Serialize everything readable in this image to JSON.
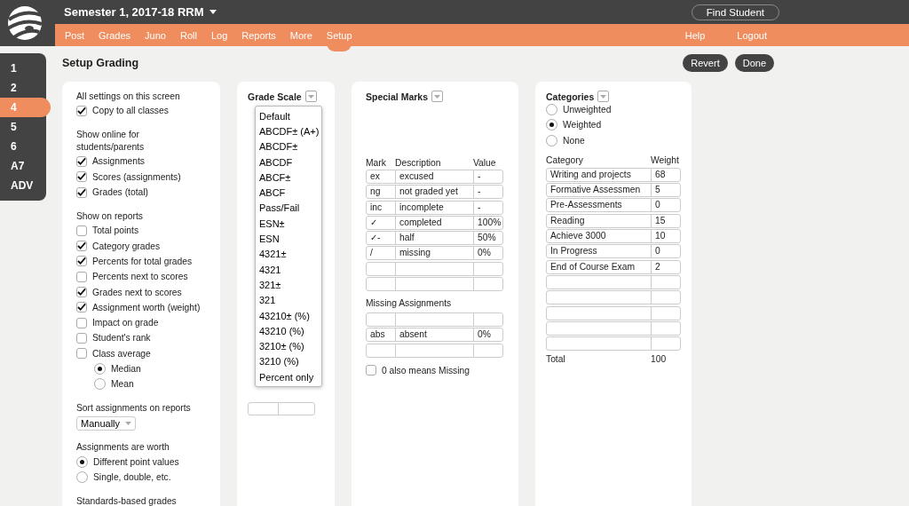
{
  "app": {
    "title": "Semester 1, 2017-18 RRM",
    "find_button": "Find Student"
  },
  "nav": {
    "items": [
      {
        "label": "Post",
        "selected": false
      },
      {
        "label": "Grades",
        "selected": false
      },
      {
        "label": "Juno",
        "selected": false
      },
      {
        "label": "Roll",
        "selected": false
      },
      {
        "label": "Log",
        "selected": false
      },
      {
        "label": "Reports",
        "selected": false
      },
      {
        "label": "More",
        "selected": false
      },
      {
        "label": "Setup",
        "selected": true
      }
    ],
    "right": [
      "Help",
      "Logout"
    ]
  },
  "class_tabs": [
    {
      "label": "1",
      "selected": false
    },
    {
      "label": "2",
      "selected": false
    },
    {
      "label": "4",
      "selected": true
    },
    {
      "label": "5",
      "selected": false
    },
    {
      "label": "6",
      "selected": false
    },
    {
      "label": "A7",
      "selected": false
    },
    {
      "label": "ADV",
      "selected": false
    }
  ],
  "page_title": "Setup Grading",
  "actions": [
    "Revert",
    "Done"
  ],
  "settings": {
    "sections": [
      {
        "heading": "All settings on this screen",
        "items": [
          {
            "kind": "checkbox",
            "label": "Copy to all classes",
            "checked": true
          }
        ]
      },
      {
        "heading": "Show online for students/parents",
        "items": [
          {
            "kind": "checkbox",
            "label": "Assignments",
            "checked": true
          },
          {
            "kind": "checkbox",
            "label": "Scores (assignments)",
            "checked": true
          },
          {
            "kind": "checkbox",
            "label": "Grades (total)",
            "checked": true
          }
        ]
      },
      {
        "heading": "Show on reports",
        "items": [
          {
            "kind": "checkbox",
            "label": "Total points",
            "checked": false
          },
          {
            "kind": "checkbox",
            "label": "Category grades",
            "checked": true
          },
          {
            "kind": "checkbox",
            "label": "Percents for total grades",
            "checked": true
          },
          {
            "kind": "checkbox",
            "label": "Percents next to scores",
            "checked": false
          },
          {
            "kind": "checkbox",
            "label": "Grades next to scores",
            "checked": true
          },
          {
            "kind": "checkbox",
            "label": "Assignment worth (weight)",
            "checked": true
          },
          {
            "kind": "checkbox",
            "label": "Impact on grade",
            "checked": false
          },
          {
            "kind": "checkbox",
            "label": "Student's rank",
            "checked": false
          },
          {
            "kind": "checkbox",
            "label": "Class average",
            "checked": false,
            "children": [
              {
                "kind": "radio",
                "label": "Median",
                "selected": true
              },
              {
                "kind": "radio",
                "label": "Mean",
                "selected": false
              }
            ]
          }
        ]
      },
      {
        "heading": "Sort assignments on reports",
        "items": [
          {
            "kind": "select",
            "value": "Manually"
          }
        ]
      },
      {
        "heading": "Assignments are worth",
        "items": [
          {
            "kind": "radio",
            "label": "Different point values",
            "selected": true
          },
          {
            "kind": "radio",
            "label": "Single, double, etc.",
            "selected": false
          }
        ]
      },
      {
        "heading": "Standards-based grades"
      }
    ]
  },
  "grade_scale": {
    "title": "Grade Scale",
    "menu": [
      "Default",
      "ABCDF± (A+)",
      "ABCDF±",
      "ABCDF",
      "ABCF±",
      "ABCF",
      "Pass/Fail",
      "ESN±",
      "ESN",
      "4321±",
      "4321",
      "321±",
      "321",
      "43210± (%)",
      "43210 (%)",
      "3210± (%)",
      "3210 (%)",
      "Percent only"
    ]
  },
  "special_marks": {
    "title": "Special Marks",
    "columns": [
      "Mark",
      "Description",
      "Value"
    ],
    "rows": [
      {
        "mark": "ex",
        "description": "excused",
        "value": "-"
      },
      {
        "mark": "ng",
        "description": "not graded yet",
        "value": "-"
      },
      {
        "mark": "inc",
        "description": "incomplete",
        "value": "-"
      },
      {
        "mark": "✓",
        "description": "completed",
        "value": "100%"
      },
      {
        "mark": "✓-",
        "description": "half",
        "value": "50%"
      },
      {
        "mark": "/",
        "description": "missing",
        "value": "0%"
      },
      {},
      {}
    ],
    "missing_heading": "Missing Assignments",
    "missing_rows": [
      {},
      {
        "mark": "abs",
        "description": "absent",
        "value": "0%"
      },
      {}
    ],
    "zero_missing": {
      "label": "0 also means Missing",
      "checked": false
    }
  },
  "categories": {
    "title": "Categories",
    "options": [
      {
        "label": "Unweighted",
        "selected": false
      },
      {
        "label": "Weighted",
        "selected": true
      },
      {
        "label": "None",
        "selected": false
      }
    ],
    "columns": [
      "Category",
      "Weight"
    ],
    "rows": [
      {
        "name": "Writing and projects",
        "weight": "68"
      },
      {
        "name": "Formative Assessmen",
        "weight": "5"
      },
      {
        "name": "Pre-Assessments",
        "weight": "0"
      },
      {
        "name": "Reading",
        "weight": "15"
      },
      {
        "name": "Achieve 3000",
        "weight": "10"
      },
      {
        "name": "In Progress",
        "weight": "0"
      },
      {
        "name": "End of Course Exam",
        "weight": "2"
      },
      {},
      {},
      {},
      {},
      {}
    ],
    "total_label": "Total",
    "total_value": "100"
  }
}
